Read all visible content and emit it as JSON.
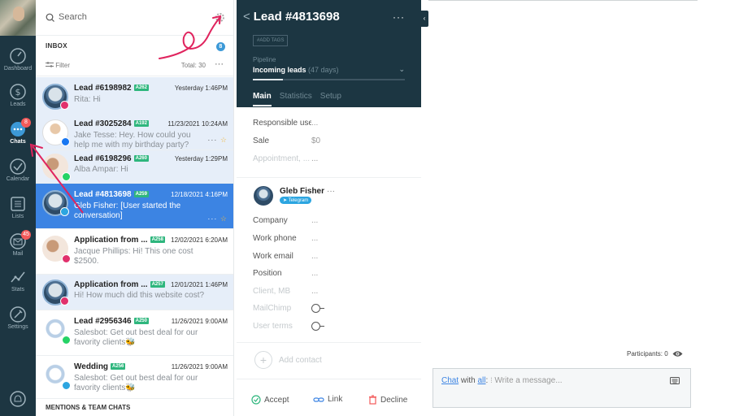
{
  "nav": {
    "items": [
      {
        "label": "Dashboard",
        "icon": "dashboard-icon"
      },
      {
        "label": "Leads",
        "icon": "leads-icon"
      },
      {
        "label": "Chats",
        "icon": "chats-icon",
        "badge": "8",
        "active": true
      },
      {
        "label": "Calendar",
        "icon": "calendar-icon"
      },
      {
        "label": "Lists",
        "icon": "lists-icon"
      },
      {
        "label": "Mail",
        "icon": "mail-icon",
        "badge": "45"
      },
      {
        "label": "Stats",
        "icon": "stats-icon"
      },
      {
        "label": "Settings",
        "icon": "settings-icon"
      }
    ]
  },
  "inbox": {
    "search_placeholder": "Search",
    "title": "INBOX",
    "badge": "8",
    "filter_label": "Filter",
    "total": "Total: 30",
    "more": "···",
    "mentions_title": "MENTIONS & TEAM CHATS",
    "items": [
      {
        "name": "Lead #6198982",
        "tag": "A262",
        "time": "Yesterday 1:46PM",
        "msg": "Rita: Hi"
      },
      {
        "name": "Lead #3025284",
        "tag": "A192",
        "time": "11/23/2021 10:24AM",
        "msg": "Jake Tesse: Hey. How could you help me with my birthday party?"
      },
      {
        "name": "Lead #6198296",
        "tag": "A260",
        "time": "Yesterday 1:29PM",
        "msg": "Alba Ampar: Hi"
      },
      {
        "name": "Lead #4813698",
        "tag": "A259",
        "time": "12/18/2021 4:16PM",
        "msg": "Gleb Fisher: [User started the conversation]"
      },
      {
        "name": "Application from ...",
        "tag": "A258",
        "time": "12/02/2021 6:20AM",
        "msg": "Jacque Phillips: Hi! This one cost $2500."
      },
      {
        "name": "Application from ...",
        "tag": "A257",
        "time": "12/01/2021 1:46PM",
        "msg": "Hi! How much did this website cost?"
      },
      {
        "name": "Lead #2956346",
        "tag": "A250",
        "time": "11/26/2021 9:00AM",
        "msg": "Salesbot: Get out best deal for our favority clients🐝"
      },
      {
        "name": "Wedding",
        "tag": "A256",
        "time": "11/26/2021 9:00AM",
        "msg": "Salesbot: Get out best deal for our favority clients🐝"
      }
    ]
  },
  "lead": {
    "title": "Lead #4813698",
    "add_tags": "#ADD TAGS",
    "pipeline_label": "Pipeline",
    "pipeline_value": "Incoming leads",
    "pipeline_days": "(47 days)",
    "pipeline_progress": 0.2,
    "tabs": [
      "Main",
      "Statistics",
      "Setup"
    ],
    "fields": [
      {
        "k": "Responsible user",
        "v": "..."
      },
      {
        "k": "Sale",
        "v": "$0"
      },
      {
        "k": "Appointment, ...",
        "v": "..."
      }
    ],
    "contact": {
      "name": "Gleb Fisher",
      "more": "···",
      "channel": "Telegram",
      "fields": [
        {
          "k": "Company",
          "v": "..."
        },
        {
          "k": "Work phone",
          "v": "..."
        },
        {
          "k": "Work email",
          "v": "..."
        },
        {
          "k": "Position",
          "v": "..."
        },
        {
          "k": "Client, MB",
          "v": "..."
        },
        {
          "k": "MailChimp",
          "v": ""
        },
        {
          "k": "User terms",
          "v": ""
        }
      ]
    },
    "add_contact": "Add contact",
    "accept": "Accept",
    "link": "Link",
    "decline": "Decline"
  },
  "chat": {
    "participants": "Participants: 0",
    "composer_chat": "Chat",
    "composer_with": "with",
    "composer_all": "all",
    "composer_placeholder": "Write a message..."
  },
  "colors": {
    "nav_bg": "#1d3642",
    "selected": "#3c84e3",
    "highlight": "#e6eef9",
    "tag_green": "#2eb67d",
    "annotation": "#e0245e"
  }
}
